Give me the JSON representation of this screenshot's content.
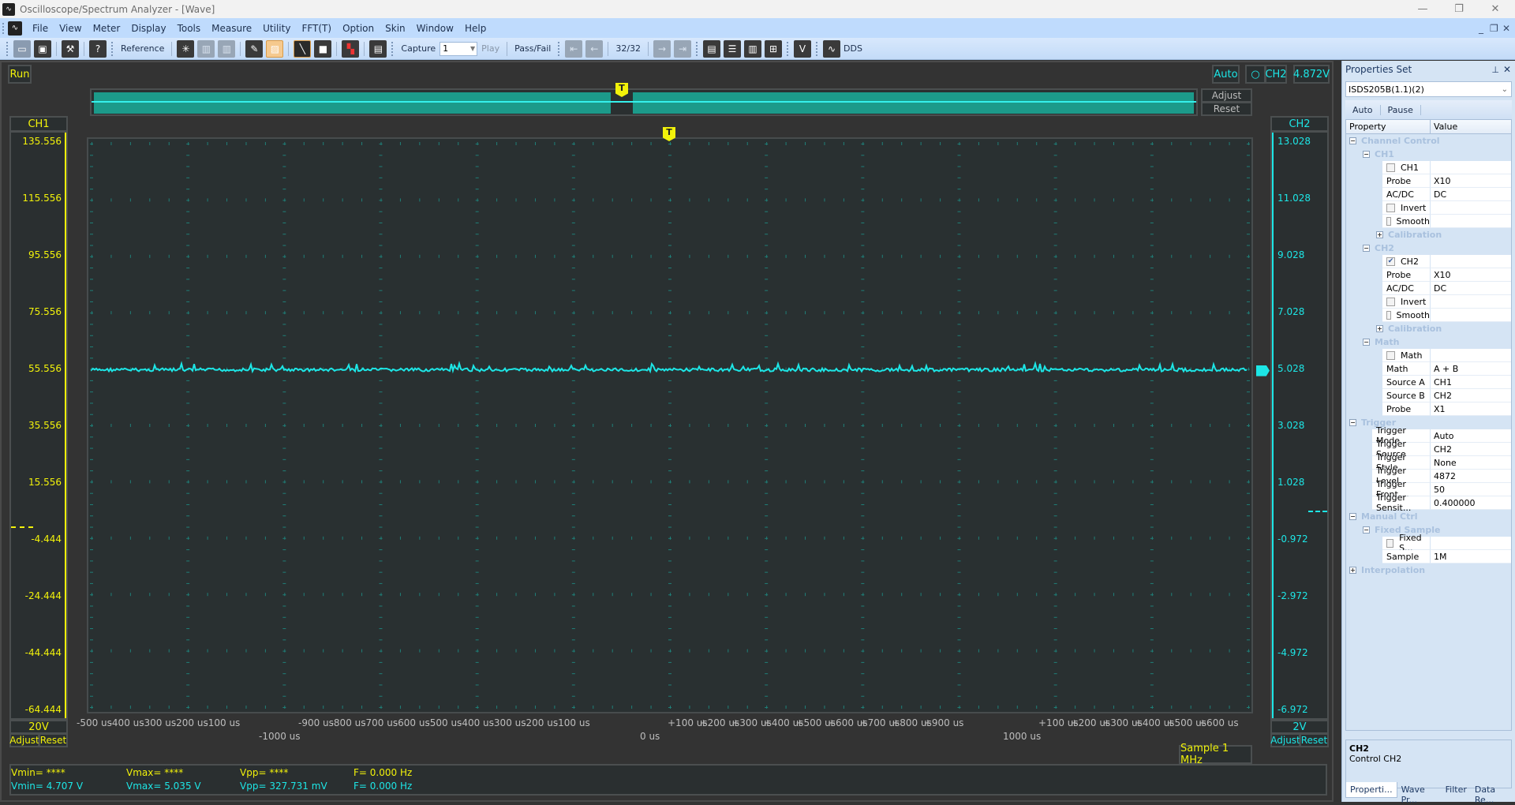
{
  "window": {
    "title": "Oscilloscope/Spectrum Analyzer - [Wave]",
    "app_icon": "waveform-app-icon",
    "controls": [
      "minimize",
      "restore",
      "close"
    ]
  },
  "menu": {
    "items": [
      "File",
      "View",
      "Meter",
      "Display",
      "Tools",
      "Measure",
      "Utility",
      "FFT(T)",
      "Option",
      "Skin",
      "Window",
      "Help"
    ]
  },
  "toolbar": {
    "reference_label": "Reference",
    "capture_label": "Capture",
    "capture_value": "1",
    "play_label": "Play",
    "passfail_label": "Pass/Fail",
    "frame_counter": "32/32",
    "dds_label": "DDS",
    "v_label": "V"
  },
  "scope": {
    "run_label": "Run",
    "trigger_mode": "Auto",
    "trigger_channel": "CH2",
    "trigger_level": "4.872V",
    "adjust_label": "Adjust",
    "reset_label": "Reset",
    "trigger_marker": "T",
    "overview_window_start": 0.47,
    "overview_window_end": 0.49
  },
  "ch1": {
    "label": "CH1",
    "scale": "20V",
    "adjust": "Adjust",
    "reset": "Reset",
    "ticks": [
      "135.556",
      "115.556",
      "95.556",
      "75.556",
      "55.556",
      "35.556",
      "15.556",
      "-4.444",
      "-24.444",
      "-44.444",
      "-64.444"
    ],
    "color": "#f2f20a"
  },
  "ch2": {
    "label": "CH2",
    "scale": "2V",
    "adjust": "Adjust",
    "reset": "Reset",
    "ticks": [
      "13.028",
      "11.028",
      "9.028",
      "7.028",
      "5.028",
      "3.028",
      "1.028",
      "-0.972",
      "-2.972",
      "-4.972",
      "-6.972"
    ],
    "color": "#1de6e6",
    "signal_level_v": 5.0
  },
  "xaxis": {
    "row1": [
      "-500 us",
      "-400 us",
      "-300 us",
      "-200 us",
      "-100 us",
      "-900 us",
      "-800 us",
      "-700 us",
      "-600 us",
      "-500 us",
      "-400 us",
      "-300 us",
      "-200 us",
      "-100 us",
      "+100 us",
      "+200 us",
      "+300 us",
      "+400 us",
      "+500 us",
      "+600 us",
      "+700 us",
      "+800 us",
      "+900 us",
      "+100 us",
      "+200 us",
      "+300 us",
      "+400 us",
      "+500 us",
      "+600 us"
    ],
    "row2": [
      "-1000 us",
      "0 us",
      "1000 us"
    ]
  },
  "sample_rate": "Sample 1 MHz",
  "measurements": {
    "ch1": {
      "vmin": "Vmin= ****",
      "vmax": "Vmax= ****",
      "vpp": "Vpp= ****",
      "freq": "F= 0.000 Hz"
    },
    "ch2": {
      "vmin": "Vmin= 4.707 V",
      "vmax": "Vmax= 5.035 V",
      "vpp": "Vpp= 327.731 mV",
      "freq": "F= 0.000 Hz"
    }
  },
  "properties": {
    "title": "Properties Set",
    "device": "ISDS205B(1.1)(2)",
    "buttons": [
      "Auto",
      "Pause"
    ],
    "col_property": "Property",
    "col_value": "Value",
    "rows": [
      {
        "type": "cat",
        "level": 0,
        "label": "Channel Control",
        "exp": "−"
      },
      {
        "type": "cat",
        "level": 1,
        "label": "CH1",
        "exp": "−"
      },
      {
        "type": "check",
        "level": 2,
        "label": "CH1",
        "checked": false,
        "value": ""
      },
      {
        "type": "prop",
        "level": 2,
        "label": "Probe",
        "value": "X10"
      },
      {
        "type": "prop",
        "level": 2,
        "label": "AC/DC",
        "value": "DC"
      },
      {
        "type": "check",
        "level": 2,
        "label": "Invert",
        "checked": false,
        "value": ""
      },
      {
        "type": "check",
        "level": 2,
        "label": "Smooth",
        "checked": false,
        "value": ""
      },
      {
        "type": "cat",
        "level": 2,
        "label": "Calibration",
        "exp": "+"
      },
      {
        "type": "cat",
        "level": 1,
        "label": "CH2",
        "exp": "−"
      },
      {
        "type": "check",
        "level": 2,
        "label": "CH2",
        "checked": true,
        "value": ""
      },
      {
        "type": "prop",
        "level": 2,
        "label": "Probe",
        "value": "X10"
      },
      {
        "type": "prop",
        "level": 2,
        "label": "AC/DC",
        "value": "DC"
      },
      {
        "type": "check",
        "level": 2,
        "label": "Invert",
        "checked": false,
        "value": ""
      },
      {
        "type": "check",
        "level": 2,
        "label": "Smooth",
        "checked": false,
        "value": ""
      },
      {
        "type": "cat",
        "level": 2,
        "label": "Calibration",
        "exp": "+"
      },
      {
        "type": "cat",
        "level": 1,
        "label": "Math",
        "exp": "−"
      },
      {
        "type": "check",
        "level": 2,
        "label": "Math",
        "checked": false,
        "value": ""
      },
      {
        "type": "prop",
        "level": 2,
        "label": "Math",
        "value": "A + B"
      },
      {
        "type": "prop",
        "level": 2,
        "label": "Source A",
        "value": "CH1"
      },
      {
        "type": "prop",
        "level": 2,
        "label": "Source B",
        "value": "CH2"
      },
      {
        "type": "prop",
        "level": 2,
        "label": "Probe",
        "value": "X1"
      },
      {
        "type": "cat",
        "level": 0,
        "label": "Trigger",
        "exp": "−"
      },
      {
        "type": "prop",
        "level": 1,
        "label": "Trigger Mode",
        "value": "Auto"
      },
      {
        "type": "prop",
        "level": 1,
        "label": "Trigger Source",
        "value": "CH2"
      },
      {
        "type": "prop",
        "level": 1,
        "label": "Trigger Style",
        "value": "None"
      },
      {
        "type": "prop",
        "level": 1,
        "label": "Trigger Level",
        "value": "4872"
      },
      {
        "type": "prop",
        "level": 1,
        "label": "Trigger Front ...",
        "value": "50"
      },
      {
        "type": "prop",
        "level": 1,
        "label": "Trigger Sensit...",
        "value": "0.400000"
      },
      {
        "type": "cat",
        "level": 0,
        "label": "Manual Ctrl",
        "exp": "−"
      },
      {
        "type": "cat",
        "level": 1,
        "label": "Fixed Sample",
        "exp": "−"
      },
      {
        "type": "check",
        "level": 2,
        "label": "Fixed S...",
        "checked": false,
        "value": ""
      },
      {
        "type": "prop",
        "level": 2,
        "label": "Sample",
        "value": "1M"
      },
      {
        "type": "cat",
        "level": 0,
        "label": "Interpolation",
        "exp": "+"
      }
    ],
    "description_title": "CH2",
    "description_text": "Control CH2",
    "tabs": [
      "Properti...",
      "Wave Pr...",
      "Filter",
      "Data Re..."
    ]
  }
}
